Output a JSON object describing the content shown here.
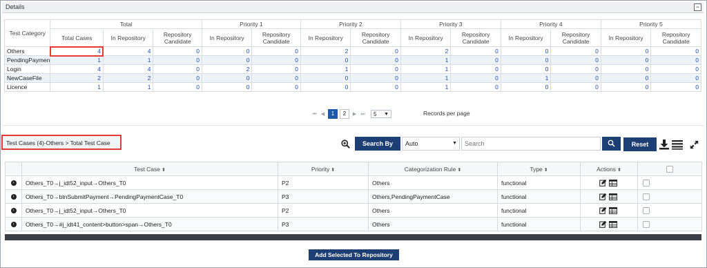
{
  "details": {
    "title": "Details",
    "collapse_symbol": "−"
  },
  "stats": {
    "category_header": "Test Category",
    "group_headers": [
      "Total",
      "Priority 1",
      "Priority 2",
      "Priority 3",
      "Priority 4",
      "Priority 5"
    ],
    "sub_headers": [
      "Total Cases",
      "In Repository",
      "Repository Candidate",
      "In Repository",
      "Repository Candidate",
      "In Repository",
      "Repository Candidate",
      "In Repository",
      "Repository Candidate",
      "In Repository",
      "Repository Candidate",
      "In Repository",
      "Repository Candidate"
    ],
    "rows": [
      {
        "category": "Others",
        "values": [
          "4",
          "4",
          "0",
          "0",
          "0",
          "2",
          "0",
          "2",
          "0",
          "0",
          "0",
          "0",
          "0"
        ]
      },
      {
        "category": "PendingPaymentCase",
        "values": [
          "1",
          "1",
          "0",
          "0",
          "0",
          "0",
          "0",
          "1",
          "0",
          "0",
          "0",
          "0",
          "0"
        ]
      },
      {
        "category": "Login",
        "values": [
          "4",
          "4",
          "0",
          "2",
          "0",
          "1",
          "0",
          "1",
          "0",
          "0",
          "0",
          "0",
          "0"
        ]
      },
      {
        "category": "NewCaseFile",
        "values": [
          "2",
          "2",
          "0",
          "0",
          "0",
          "0",
          "0",
          "1",
          "0",
          "1",
          "0",
          "0",
          "0"
        ]
      },
      {
        "category": "Licence",
        "values": [
          "1",
          "1",
          "0",
          "0",
          "0",
          "0",
          "0",
          "1",
          "0",
          "0",
          "0",
          "0",
          "0"
        ]
      }
    ]
  },
  "pager": {
    "pages": [
      "1",
      "2"
    ],
    "active_page": "1",
    "per_page": "5",
    "per_page_label": "Records per page"
  },
  "breadcrumb": "Test Cases (4)-Others > Total Test Case",
  "toolbar": {
    "search_by_label": "Search By",
    "search_by_value": "Auto",
    "search_placeholder": "Search",
    "reset_label": "Reset",
    "icons": [
      "zoom-in-icon",
      "search-icon",
      "download-icon",
      "columns-icon",
      "expand-icon"
    ]
  },
  "grid": {
    "headers": [
      "Test Case",
      "Priority",
      "Categorization Rule",
      "Type",
      "Actions"
    ],
    "rows": [
      {
        "test_case": "Others_T0→j_idt52_input→Others_T0",
        "priority": "P2",
        "rule": "Others",
        "type": "functional"
      },
      {
        "test_case": "Others_T0→btnSubmitPayment→PendingPaymentCase_T0",
        "priority": "P3",
        "rule": "Others,PendingPaymentCase",
        "type": "functional"
      },
      {
        "test_case": "Others_T0→j_idt52_input→Others_T0",
        "priority": "P2",
        "rule": "Others",
        "type": "functional"
      },
      {
        "test_case": "Others_T0→#j_idt41_content>button>span→Others_T0",
        "priority": "P3",
        "rule": "Others",
        "type": "functional"
      }
    ]
  },
  "add_button_label": "Add Selected To Repository",
  "colors": {
    "primary_button": "#1d3f73",
    "link_number": "#1a4fb5",
    "highlight": "#e53935",
    "alt_row": "#eef3fa"
  }
}
